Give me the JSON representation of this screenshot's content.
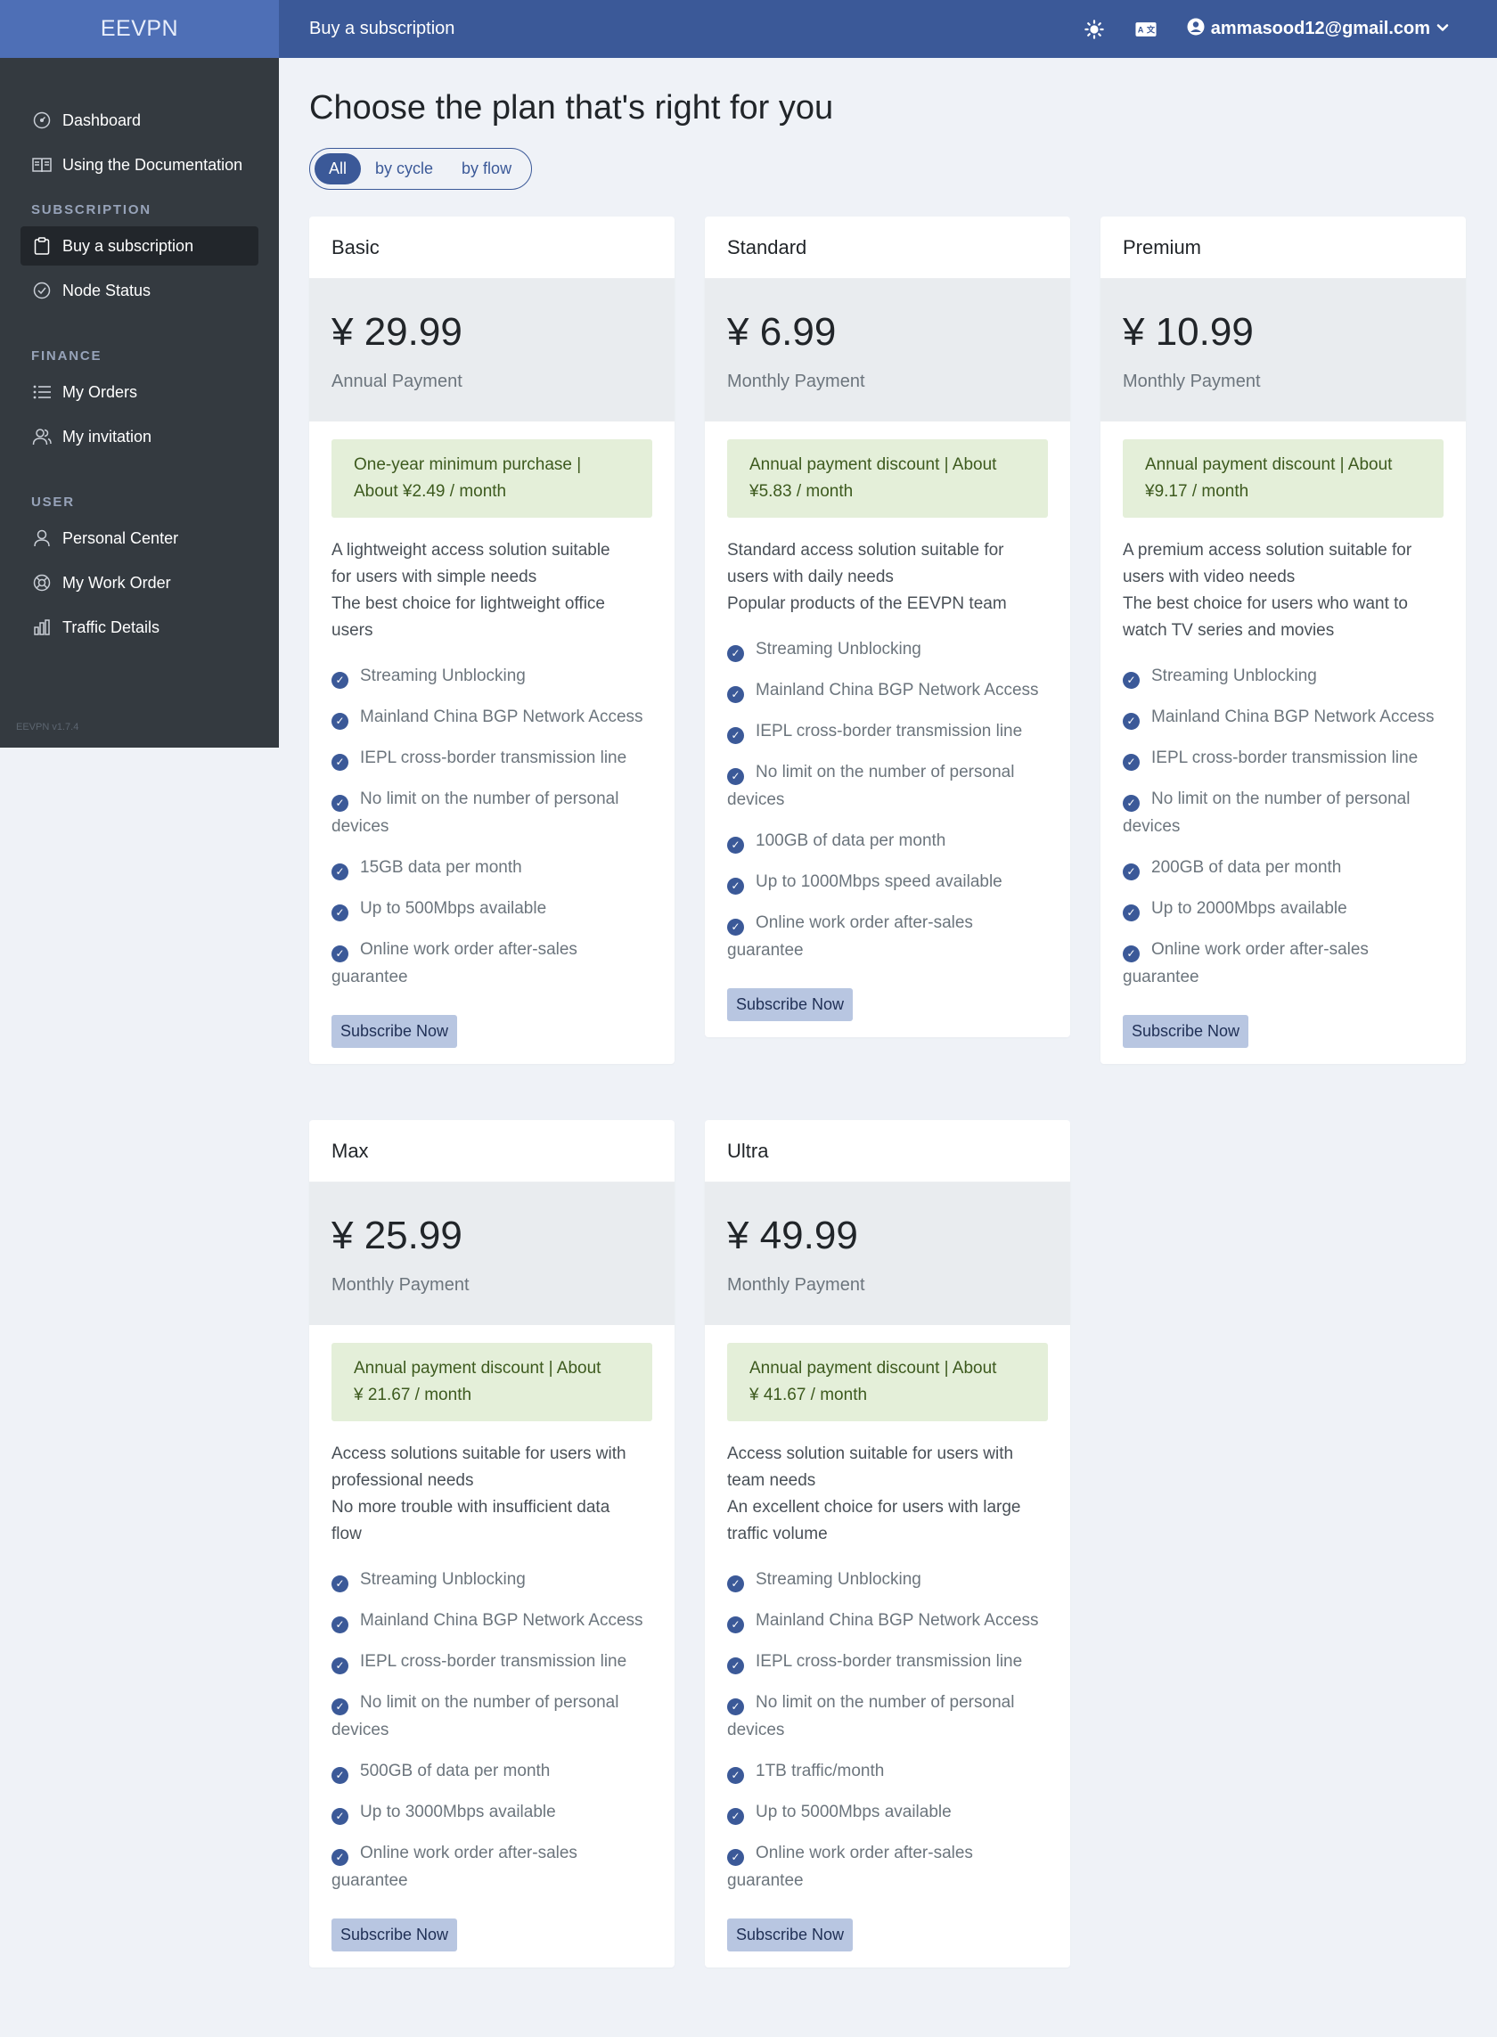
{
  "brand": "EEVPN",
  "header": {
    "title": "Buy a subscription",
    "account": "ammasood12@gmail.com"
  },
  "sidebar": {
    "items_top": [
      {
        "label": "Dashboard",
        "icon": "dashboard-icon"
      },
      {
        "label": "Using the Documentation",
        "icon": "book-icon"
      }
    ],
    "sections": [
      {
        "title": "SUBSCRIPTION",
        "items": [
          {
            "label": "Buy a subscription",
            "icon": "clipboard-icon",
            "active": true
          },
          {
            "label": "Node Status",
            "icon": "check-circle-icon"
          }
        ]
      },
      {
        "title": "FINANCE",
        "items": [
          {
            "label": "My Orders",
            "icon": "list-icon"
          },
          {
            "label": "My invitation",
            "icon": "users-icon"
          }
        ]
      },
      {
        "title": "USER",
        "items": [
          {
            "label": "Personal Center",
            "icon": "user-icon"
          },
          {
            "label": "My Work Order",
            "icon": "lifebuoy-icon"
          },
          {
            "label": "Traffic Details",
            "icon": "bar-chart-icon"
          }
        ]
      }
    ],
    "version": "EEVPN v1.7.4"
  },
  "main": {
    "title": "Choose the plan that's right for you",
    "filters": [
      "All",
      "by cycle",
      "by flow"
    ],
    "active_filter": "All",
    "subscribe_label": "Subscribe Now",
    "plans": [
      {
        "name": "Basic",
        "price": "¥ 29.99",
        "period": "Annual Payment",
        "discount": [
          "One-year minimum purchase |",
          "About ¥2.49 / month"
        ],
        "description": [
          "A lightweight access solution suitable",
          "for users with simple needs",
          "The best choice for lightweight office",
          "users"
        ],
        "features": [
          "Streaming Unblocking",
          "Mainland China BGP Network Access",
          "IEPL cross-border transmission line",
          "No limit on the number of personal devices",
          "15GB data per month",
          "Up to 500Mbps available",
          "Online work order after-sales guarantee"
        ]
      },
      {
        "name": "Standard",
        "price": "¥ 6.99",
        "period": "Monthly Payment",
        "discount": [
          "Annual payment discount | About",
          "¥5.83 / month"
        ],
        "description": [
          "Standard access solution suitable for",
          "users with daily needs",
          "Popular products of the EEVPN team"
        ],
        "features": [
          "Streaming Unblocking",
          "Mainland China BGP Network Access",
          "IEPL cross-border transmission line",
          "No limit on the number of personal devices",
          "100GB of data per month",
          "Up to 1000Mbps speed available",
          "Online work order after-sales guarantee"
        ]
      },
      {
        "name": "Premium",
        "price": "¥ 10.99",
        "period": "Monthly Payment",
        "discount": [
          "Annual payment discount | About",
          "¥9.17 / month"
        ],
        "description": [
          "A premium access solution suitable for",
          "users with video needs",
          "The best choice for users who want to",
          "watch TV series and movies"
        ],
        "features": [
          "Streaming Unblocking",
          "Mainland China BGP Network Access",
          "IEPL cross-border transmission line",
          "No limit on the number of personal devices",
          "200GB of data per month",
          "Up to 2000Mbps available",
          "Online work order after-sales guarantee"
        ]
      },
      {
        "name": "Max",
        "price": "¥ 25.99",
        "period": "Monthly Payment",
        "discount": [
          "Annual payment discount | About",
          "¥ 21.67 / month"
        ],
        "description": [
          "Access solutions suitable for users with",
          "professional needs",
          "No more trouble with insufficient data",
          "flow"
        ],
        "features": [
          "Streaming Unblocking",
          "Mainland China BGP Network Access",
          "IEPL cross-border transmission line",
          "No limit on the number of personal devices",
          "500GB of data per month",
          "Up to 3000Mbps available",
          "Online work order after-sales guarantee"
        ]
      },
      {
        "name": "Ultra",
        "price": "¥ 49.99",
        "period": "Monthly Payment",
        "discount": [
          "Annual payment discount | About",
          "¥ 41.67 / month"
        ],
        "description": [
          "Access solution suitable for users with",
          "team needs",
          "An excellent choice for users with large",
          "traffic volume"
        ],
        "features": [
          "Streaming Unblocking",
          "Mainland China BGP Network Access",
          "IEPL cross-border transmission line",
          "No limit on the number of personal devices",
          "1TB traffic/month",
          "Up to 5000Mbps available",
          "Online work order after-sales guarantee"
        ]
      }
    ]
  },
  "colors": {
    "header": "#3b5998",
    "brand": "#4e6fb6",
    "sidebar": "#343a40",
    "discount_bg": "#e4efd9",
    "subscribe_bg": "#b8c6e1"
  }
}
